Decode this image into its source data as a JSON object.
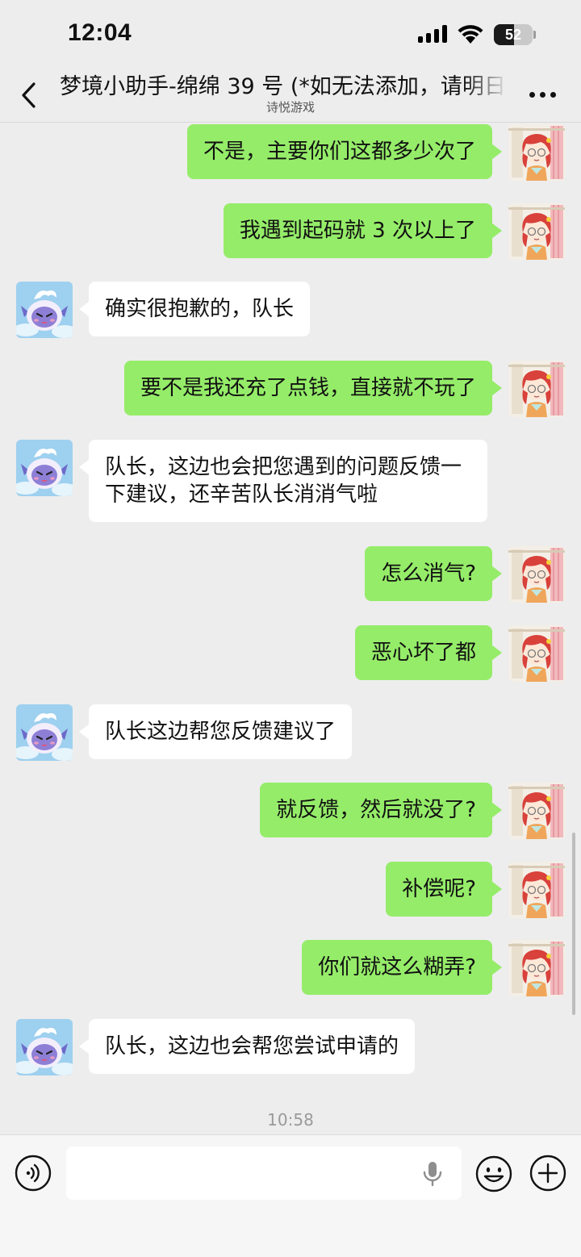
{
  "status": {
    "time": "12:04",
    "battery": "52",
    "battery_level_pct": 52
  },
  "header": {
    "title": "梦境小助手-绵绵 39 号 (*如无法添加，请明日",
    "subtitle": "诗悦游戏",
    "back_icon": "chevron-left-icon",
    "more_icon": "more-dots-icon"
  },
  "messages": [
    {
      "sender": "me",
      "text": "不是，主要你们这都多少次了"
    },
    {
      "sender": "me",
      "text": "我遇到起码就 3 次以上了"
    },
    {
      "sender": "bot",
      "text": "确实很抱歉的，队长"
    },
    {
      "sender": "me",
      "text": "要不是我还充了点钱，直接就不玩了"
    },
    {
      "sender": "bot",
      "text": "队长，这边也会把您遇到的问题反馈一下建议，还辛苦队长消消气啦"
    },
    {
      "sender": "me",
      "text": "怎么消气?"
    },
    {
      "sender": "me",
      "text": "恶心坏了都"
    },
    {
      "sender": "bot",
      "text": "队长这边帮您反馈建议了"
    },
    {
      "sender": "me",
      "text": "就反馈，然后就没了?"
    },
    {
      "sender": "me",
      "text": "补偿呢?"
    },
    {
      "sender": "me",
      "text": "你们就这么糊弄?"
    },
    {
      "sender": "bot",
      "text": "队长，这边也会帮您尝试申请的"
    }
  ],
  "timestamp": "10:58",
  "input": {
    "value": "",
    "placeholder": ""
  },
  "colors": {
    "me_bubble": "#95ec69",
    "bot_bubble": "#ffffff",
    "background": "#ededed"
  }
}
